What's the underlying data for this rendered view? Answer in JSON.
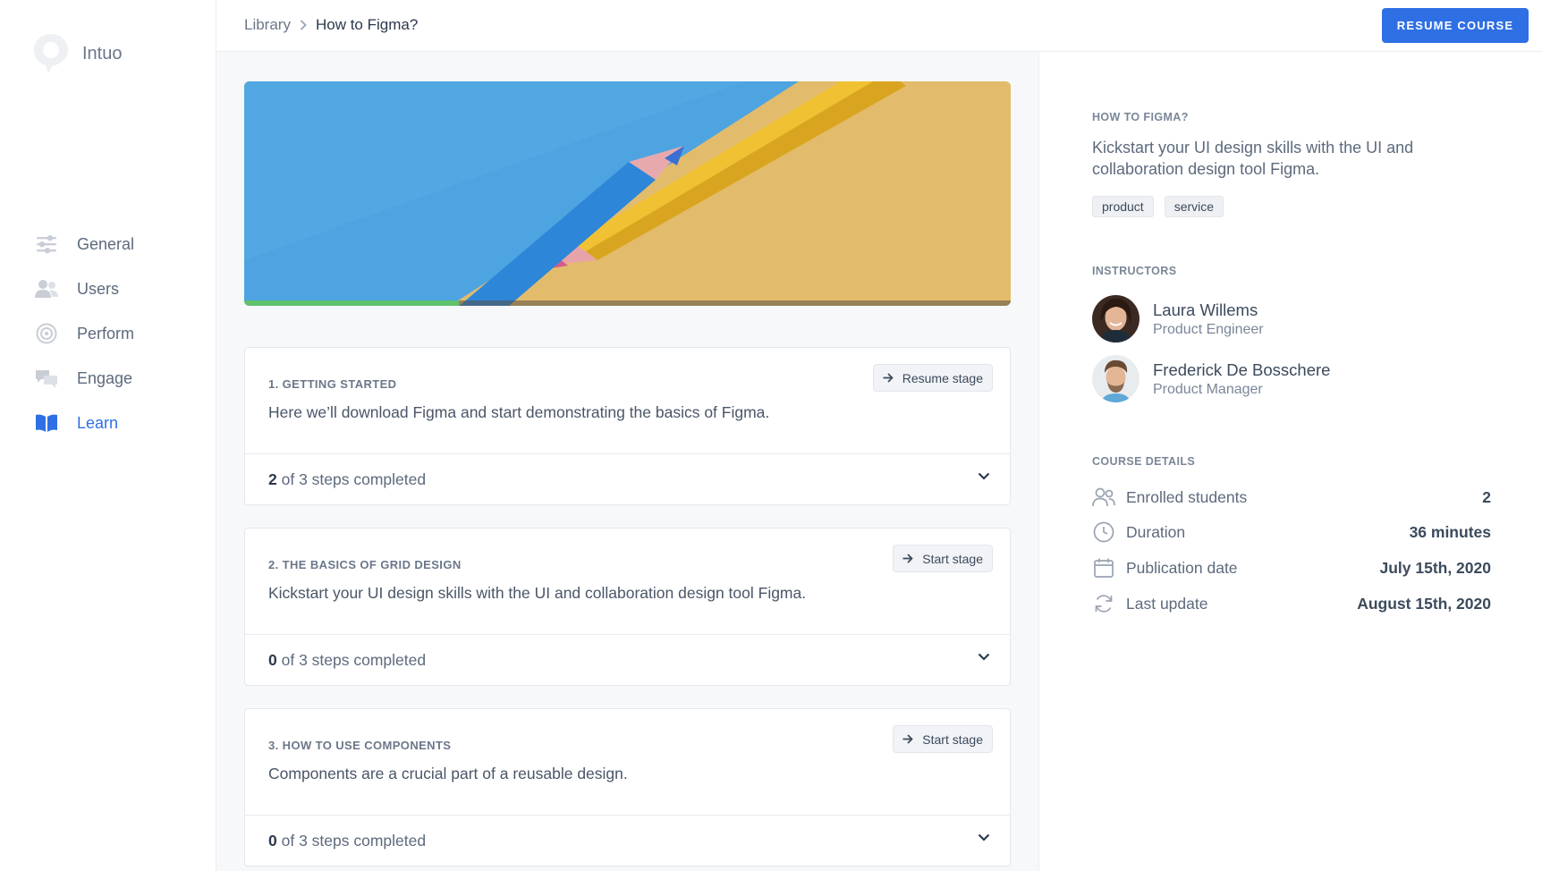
{
  "brand": {
    "name": "Intuo"
  },
  "nav": {
    "items": [
      {
        "label": "General",
        "icon": "sliders-icon"
      },
      {
        "label": "Users",
        "icon": "users-icon"
      },
      {
        "label": "Perform",
        "icon": "target-icon"
      },
      {
        "label": "Engage",
        "icon": "chat-bubbles-icon"
      },
      {
        "label": "Learn",
        "icon": "book-open-icon",
        "active": true
      }
    ]
  },
  "header": {
    "breadcrumb_root": "Library",
    "breadcrumb_current": "How to Figma?",
    "resume_course_label": "RESUME COURSE"
  },
  "course": {
    "progress_fraction": 0.28,
    "stages": [
      {
        "title": "1. GETTING STARTED",
        "description": "Here we’ll download Figma and start demonstrating the basics of Figma.",
        "button_label": "Resume stage",
        "completed": "2",
        "progress_text": "of 3 steps completed"
      },
      {
        "title": "2. THE BASICS OF GRID DESIGN",
        "description": "Kickstart your UI design skills with the UI  and collaboration design tool Figma.",
        "button_label": "Start stage",
        "completed": "0",
        "progress_text": "of 3 steps completed"
      },
      {
        "title": "3. HOW TO USE COMPONENTS",
        "description": "Components are a crucial part of a reusable design.",
        "button_label": "Start stage",
        "completed": "0",
        "progress_text": "of 3 steps completed"
      }
    ]
  },
  "panel": {
    "course_label": "HOW TO FIGMA?",
    "course_description": "Kickstart your UI design skills with the UI  and collaboration design tool Figma.",
    "tags": [
      "product",
      "service"
    ],
    "instructors_label": "INSTRUCTORS",
    "instructors": [
      {
        "name": "Laura Willems",
        "role": "Product Engineer"
      },
      {
        "name": "Frederick De Bosschere",
        "role": "Product Manager"
      }
    ],
    "details_label": "COURSE DETAILS",
    "details": [
      {
        "label": "Enrolled students",
        "value": "2",
        "icon": "users-icon"
      },
      {
        "label": "Duration",
        "value": "36 minutes",
        "icon": "clock-icon"
      },
      {
        "label": "Publication date",
        "value": "July 15th, 2020",
        "icon": "calendar-icon"
      },
      {
        "label": "Last update",
        "value": "August 15th, 2020",
        "icon": "refresh-icon"
      }
    ]
  },
  "colors": {
    "accent": "#2f6fe4",
    "progress": "#5fc36b"
  }
}
